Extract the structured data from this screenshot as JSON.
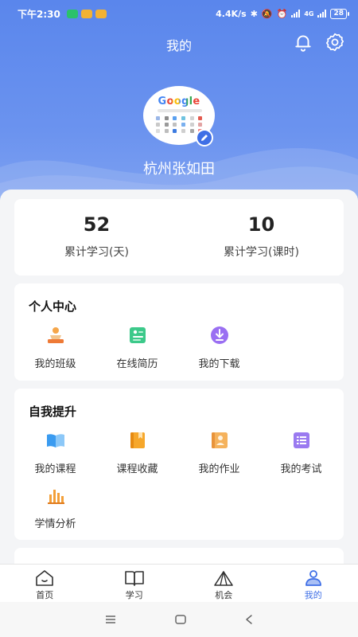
{
  "status_bar": {
    "time": "下午2:30",
    "network_speed": "4.4K/s",
    "signal_tag": "4G",
    "battery": "28"
  },
  "header": {
    "title": "我的"
  },
  "profile": {
    "name": "杭州张如田",
    "avatar_text": "Google"
  },
  "stats": [
    {
      "value": "52",
      "label": "累计学习(天)"
    },
    {
      "value": "10",
      "label": "累计学习(课时)"
    }
  ],
  "personal_center": {
    "title": "个人中心",
    "items": [
      {
        "label": "我的班级",
        "icon": "class-icon"
      },
      {
        "label": "在线简历",
        "icon": "resume-icon"
      },
      {
        "label": "我的下载",
        "icon": "download-icon"
      }
    ]
  },
  "self_improve": {
    "title": "自我提升",
    "items": [
      {
        "label": "我的课程",
        "icon": "course-icon"
      },
      {
        "label": "课程收藏",
        "icon": "favorite-icon"
      },
      {
        "label": "我的作业",
        "icon": "homework-icon"
      },
      {
        "label": "我的考试",
        "icon": "exam-icon"
      },
      {
        "label": "学情分析",
        "icon": "analysis-icon"
      }
    ]
  },
  "tabbar": {
    "items": [
      {
        "label": "首页",
        "icon": "home-icon"
      },
      {
        "label": "学习",
        "icon": "book-icon"
      },
      {
        "label": "机会",
        "icon": "tent-icon"
      },
      {
        "label": "我的",
        "icon": "profile-icon",
        "active": true
      }
    ]
  },
  "colors": {
    "accent": "#3f6fe6",
    "header_bg": "#5a86ec"
  }
}
